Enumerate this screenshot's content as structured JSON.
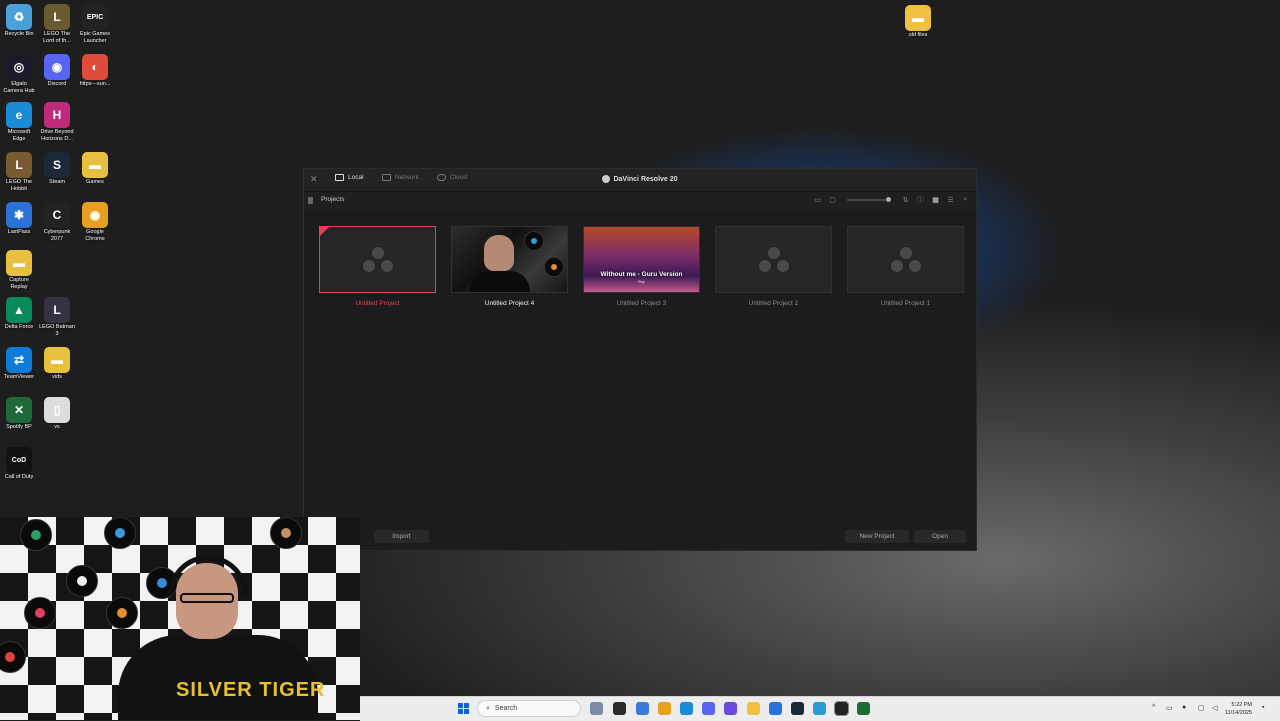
{
  "desktop": {
    "icons": [
      {
        "label": "Recycle Bin",
        "glyph": "♻",
        "color": "#4aa0d8"
      },
      {
        "label": "LEGO The Lord of th...",
        "glyph": "L",
        "color": "#6a5a30"
      },
      {
        "label": "Epic Games Launcher",
        "glyph": "EPIC",
        "color": "#222222"
      },
      {
        "label": "Elgato Camera Hub",
        "glyph": "◎",
        "color": "#1a1a2a"
      },
      {
        "label": "Discord",
        "glyph": "◉",
        "color": "#5865f2"
      },
      {
        "label": "https---sun...",
        "glyph": "◐",
        "color": "#e04a3a"
      },
      {
        "label": "Microsoft Edge",
        "glyph": "e",
        "color": "#1b8bd8"
      },
      {
        "label": "Drive Beyond Horizons D...",
        "glyph": "H",
        "color": "#c02a7a"
      },
      {
        "label": "LEGO The Hobbit",
        "glyph": "L",
        "color": "#7a5a30"
      },
      {
        "label": "Steam",
        "glyph": "S",
        "color": "#1b2838"
      },
      {
        "label": "Games",
        "glyph": "▬",
        "color": "#e8c040"
      },
      {
        "label": "LastPass",
        "glyph": "✱",
        "color": "#2a72d8"
      },
      {
        "label": "Cyberpunk 2077",
        "glyph": "C",
        "color": "#222222"
      },
      {
        "label": "Google Chrome",
        "glyph": "◉",
        "color": "#e8a020"
      },
      {
        "label": "Capture Replay",
        "glyph": "▬",
        "color": "#e8c040"
      },
      {
        "label": "Delta Force",
        "glyph": "▲",
        "color": "#0a8a5a"
      },
      {
        "label": "LEGO Batman 3",
        "glyph": "L",
        "color": "#333344"
      },
      {
        "label": "TeamViewer",
        "glyph": "⇄",
        "color": "#0e7bd8"
      },
      {
        "label": "vids",
        "glyph": "▬",
        "color": "#e8c040"
      },
      {
        "label": "Spotify BP",
        "glyph": "✕",
        "color": "#1e6a3a"
      },
      {
        "label": "vs",
        "glyph": "▯",
        "color": "#dddddd"
      },
      {
        "label": "Call of Duty",
        "glyph": "CoD",
        "color": "#111111"
      },
      {
        "label": "old files",
        "glyph": "▬",
        "color": "#f0c040"
      }
    ]
  },
  "resolve": {
    "app_title": "DaVinci Resolve 20",
    "tabs": [
      {
        "label": "Local",
        "active": true
      },
      {
        "label": "Network",
        "active": false
      },
      {
        "label": "Cloud",
        "active": false
      }
    ],
    "section_label": "Projects",
    "projects": [
      {
        "name": "Untitled Project",
        "state": "selected",
        "thumb": "blank"
      },
      {
        "name": "Untitled Project 4",
        "state": "hover",
        "thumb": "photo"
      },
      {
        "name": "Untitled Project 3",
        "state": "normal",
        "thumb": "art",
        "thumb_title": "Without me - Guru Version",
        "thumb_sub": "Rap"
      },
      {
        "name": "Untitled Project 2",
        "state": "normal",
        "thumb": "blank"
      },
      {
        "name": "Untitled Project 1",
        "state": "normal",
        "thumb": "blank"
      }
    ],
    "buttons": {
      "import": "Import",
      "new_project": "New Project",
      "open": "Open"
    },
    "accent_color": "#e0454f"
  },
  "webcam": {
    "shirt_text": "SILVER TIGER"
  },
  "taskbar": {
    "search_placeholder": "Search",
    "time": "5:22 PM",
    "date": "11/14/2025"
  }
}
